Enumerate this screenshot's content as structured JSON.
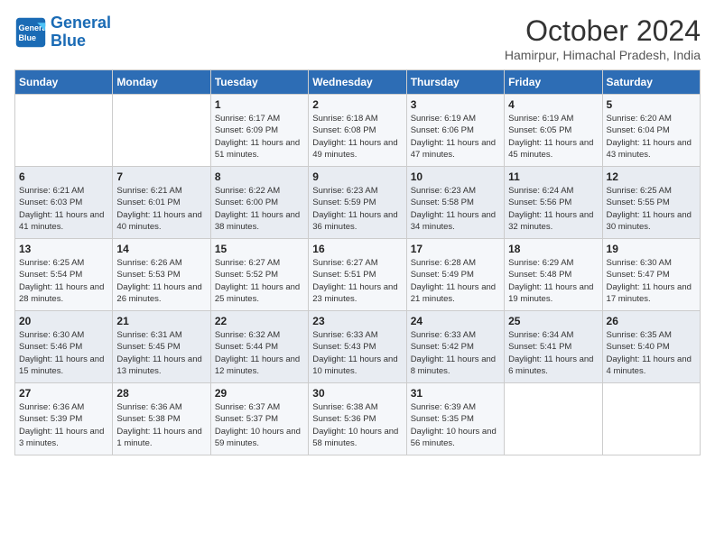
{
  "logo": {
    "line1": "General",
    "line2": "Blue"
  },
  "title": "October 2024",
  "subtitle": "Hamirpur, Himachal Pradesh, India",
  "days_of_week": [
    "Sunday",
    "Monday",
    "Tuesday",
    "Wednesday",
    "Thursday",
    "Friday",
    "Saturday"
  ],
  "weeks": [
    [
      {
        "day": "",
        "info": ""
      },
      {
        "day": "",
        "info": ""
      },
      {
        "day": "1",
        "info": "Sunrise: 6:17 AM\nSunset: 6:09 PM\nDaylight: 11 hours and 51 minutes."
      },
      {
        "day": "2",
        "info": "Sunrise: 6:18 AM\nSunset: 6:08 PM\nDaylight: 11 hours and 49 minutes."
      },
      {
        "day": "3",
        "info": "Sunrise: 6:19 AM\nSunset: 6:06 PM\nDaylight: 11 hours and 47 minutes."
      },
      {
        "day": "4",
        "info": "Sunrise: 6:19 AM\nSunset: 6:05 PM\nDaylight: 11 hours and 45 minutes."
      },
      {
        "day": "5",
        "info": "Sunrise: 6:20 AM\nSunset: 6:04 PM\nDaylight: 11 hours and 43 minutes."
      }
    ],
    [
      {
        "day": "6",
        "info": "Sunrise: 6:21 AM\nSunset: 6:03 PM\nDaylight: 11 hours and 41 minutes."
      },
      {
        "day": "7",
        "info": "Sunrise: 6:21 AM\nSunset: 6:01 PM\nDaylight: 11 hours and 40 minutes."
      },
      {
        "day": "8",
        "info": "Sunrise: 6:22 AM\nSunset: 6:00 PM\nDaylight: 11 hours and 38 minutes."
      },
      {
        "day": "9",
        "info": "Sunrise: 6:23 AM\nSunset: 5:59 PM\nDaylight: 11 hours and 36 minutes."
      },
      {
        "day": "10",
        "info": "Sunrise: 6:23 AM\nSunset: 5:58 PM\nDaylight: 11 hours and 34 minutes."
      },
      {
        "day": "11",
        "info": "Sunrise: 6:24 AM\nSunset: 5:56 PM\nDaylight: 11 hours and 32 minutes."
      },
      {
        "day": "12",
        "info": "Sunrise: 6:25 AM\nSunset: 5:55 PM\nDaylight: 11 hours and 30 minutes."
      }
    ],
    [
      {
        "day": "13",
        "info": "Sunrise: 6:25 AM\nSunset: 5:54 PM\nDaylight: 11 hours and 28 minutes."
      },
      {
        "day": "14",
        "info": "Sunrise: 6:26 AM\nSunset: 5:53 PM\nDaylight: 11 hours and 26 minutes."
      },
      {
        "day": "15",
        "info": "Sunrise: 6:27 AM\nSunset: 5:52 PM\nDaylight: 11 hours and 25 minutes."
      },
      {
        "day": "16",
        "info": "Sunrise: 6:27 AM\nSunset: 5:51 PM\nDaylight: 11 hours and 23 minutes."
      },
      {
        "day": "17",
        "info": "Sunrise: 6:28 AM\nSunset: 5:49 PM\nDaylight: 11 hours and 21 minutes."
      },
      {
        "day": "18",
        "info": "Sunrise: 6:29 AM\nSunset: 5:48 PM\nDaylight: 11 hours and 19 minutes."
      },
      {
        "day": "19",
        "info": "Sunrise: 6:30 AM\nSunset: 5:47 PM\nDaylight: 11 hours and 17 minutes."
      }
    ],
    [
      {
        "day": "20",
        "info": "Sunrise: 6:30 AM\nSunset: 5:46 PM\nDaylight: 11 hours and 15 minutes."
      },
      {
        "day": "21",
        "info": "Sunrise: 6:31 AM\nSunset: 5:45 PM\nDaylight: 11 hours and 13 minutes."
      },
      {
        "day": "22",
        "info": "Sunrise: 6:32 AM\nSunset: 5:44 PM\nDaylight: 11 hours and 12 minutes."
      },
      {
        "day": "23",
        "info": "Sunrise: 6:33 AM\nSunset: 5:43 PM\nDaylight: 11 hours and 10 minutes."
      },
      {
        "day": "24",
        "info": "Sunrise: 6:33 AM\nSunset: 5:42 PM\nDaylight: 11 hours and 8 minutes."
      },
      {
        "day": "25",
        "info": "Sunrise: 6:34 AM\nSunset: 5:41 PM\nDaylight: 11 hours and 6 minutes."
      },
      {
        "day": "26",
        "info": "Sunrise: 6:35 AM\nSunset: 5:40 PM\nDaylight: 11 hours and 4 minutes."
      }
    ],
    [
      {
        "day": "27",
        "info": "Sunrise: 6:36 AM\nSunset: 5:39 PM\nDaylight: 11 hours and 3 minutes."
      },
      {
        "day": "28",
        "info": "Sunrise: 6:36 AM\nSunset: 5:38 PM\nDaylight: 11 hours and 1 minute."
      },
      {
        "day": "29",
        "info": "Sunrise: 6:37 AM\nSunset: 5:37 PM\nDaylight: 10 hours and 59 minutes."
      },
      {
        "day": "30",
        "info": "Sunrise: 6:38 AM\nSunset: 5:36 PM\nDaylight: 10 hours and 58 minutes."
      },
      {
        "day": "31",
        "info": "Sunrise: 6:39 AM\nSunset: 5:35 PM\nDaylight: 10 hours and 56 minutes."
      },
      {
        "day": "",
        "info": ""
      },
      {
        "day": "",
        "info": ""
      }
    ]
  ]
}
